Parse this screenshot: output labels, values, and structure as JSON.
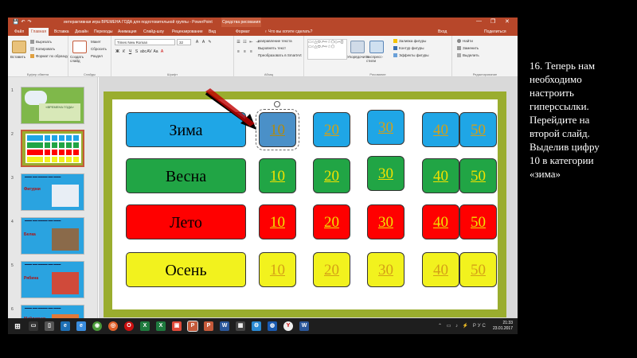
{
  "window": {
    "title": "интерактивная игра ВРЕМЕНА ГОДА  для подготовительной группы  -  PowerPoint",
    "context_tab": "Средства рисования",
    "window_buttons": [
      "—",
      "❐",
      "✕"
    ]
  },
  "tabs": {
    "file": "Файл",
    "items": [
      "Главная",
      "Вставка",
      "Дизайн",
      "Переходы",
      "Анимация",
      "Слайд-шоу",
      "Рецензирование",
      "Вид",
      "Формат"
    ],
    "search": "♀ Что вы хотите сделать?",
    "user": "Вход",
    "share": "Поделиться"
  },
  "ribbon": {
    "clipboard": {
      "paste": "Вставить",
      "cut": "Вырезать",
      "copy": "Копировать",
      "format": "Формат по образцу",
      "label": "Буфер обмена"
    },
    "slides": {
      "new": "Создать слайд",
      "layout": "Макет",
      "reset": "Сбросить",
      "section": "Раздел",
      "label": "Слайды"
    },
    "font": {
      "name": "Times New Roman",
      "size": "32",
      "label": "Шрифт"
    },
    "paragraph": {
      "direction": "Направление текста",
      "align": "Выровнять текст",
      "smartart": "Преобразовать в SmartArt",
      "label": "Абзац"
    },
    "drawing": {
      "arrange": "Упорядочить",
      "styles": "Экспресс-стили",
      "fill": "Заливка фигуры",
      "outline": "Контур фигуры",
      "effects": "Эффекты фигуры",
      "label": "Рисование"
    },
    "editing": {
      "find": "Найти",
      "replace": "Заменить",
      "select": "Выделить",
      "label": "Редактирование"
    }
  },
  "thumbnails": [
    {
      "num": "1",
      "title": "«ВРЕМЕНА ГОДА»"
    },
    {
      "num": "2"
    },
    {
      "num": "3",
      "caption": "Фигурки"
    },
    {
      "num": "4",
      "caption": "Белка"
    },
    {
      "num": "5",
      "caption": "Рябина"
    },
    {
      "num": "6",
      "caption": "Майдавчик"
    }
  ],
  "slide": {
    "rows": [
      {
        "category": "Зима",
        "color": "#1fa6e6",
        "cells": [
          "10",
          "20",
          "30",
          "40",
          "50"
        ],
        "text_color": "#d4a017"
      },
      {
        "category": "Весна",
        "color": "#21a545",
        "cells": [
          "10",
          "20",
          "30",
          "40",
          "50"
        ],
        "text_color": "#f2e200"
      },
      {
        "category": "Лето",
        "color": "#ff0000",
        "cells": [
          "10",
          "20",
          "30",
          "40",
          "50"
        ],
        "text_color": "#f2e200"
      },
      {
        "category": "Осень",
        "color": "#f2f21e",
        "cells": [
          "10",
          "20",
          "30",
          "40",
          "50"
        ],
        "text_color": "#d4a017"
      }
    ],
    "selected_cell_color": "#4a90c8"
  },
  "status": {
    "slide": "Слайд 2 из 22",
    "lang": "русский",
    "notes": "Заметки",
    "zoom": "52%"
  },
  "taskbar": {
    "time": "21:33",
    "date": "23.01.2017"
  },
  "caption": "16. Теперь нам\nнеобходимо\nнастроить\nгиперссылки.\nПерейдите на\nвторой слайд.\nВыделив цифру\n10 в категории\n«зима»"
}
